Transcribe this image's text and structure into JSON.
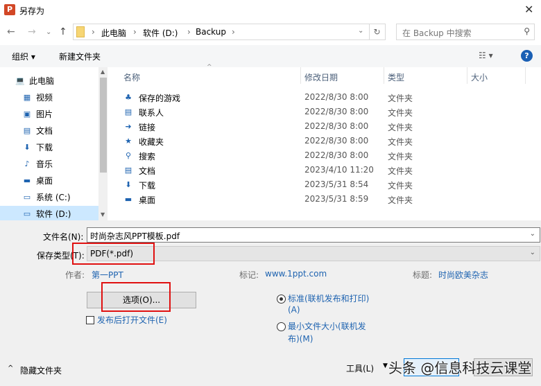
{
  "window": {
    "title": "另存为",
    "close": "✕"
  },
  "address": {
    "crumbs": [
      "此电脑",
      "软件 (D:)",
      "Backup"
    ],
    "search_placeholder": "在 Backup 中搜索"
  },
  "toolbar": {
    "organize": "组织 ▾",
    "new_folder": "新建文件夹",
    "view": "☷ ▾",
    "help": "?"
  },
  "nav": [
    {
      "label": "此电脑",
      "icon": "💻"
    },
    {
      "label": "视频",
      "icon": "▦"
    },
    {
      "label": "图片",
      "icon": "▣"
    },
    {
      "label": "文档",
      "icon": "▤"
    },
    {
      "label": "下载",
      "icon": "⬇"
    },
    {
      "label": "音乐",
      "icon": "♪"
    },
    {
      "label": "桌面",
      "icon": "▬"
    },
    {
      "label": "系统 (C:)",
      "icon": "▭"
    },
    {
      "label": "软件 (D:)",
      "icon": "▭"
    }
  ],
  "columns": {
    "name": "名称",
    "date": "修改日期",
    "type": "类型",
    "size": "大小"
  },
  "files": [
    {
      "name": "保存的游戏",
      "date": "2022/8/30 8:00",
      "type": "文件夹",
      "icon": "♣"
    },
    {
      "name": "联系人",
      "date": "2022/8/30 8:00",
      "type": "文件夹",
      "icon": "▤"
    },
    {
      "name": "链接",
      "date": "2022/8/30 8:00",
      "type": "文件夹",
      "icon": "➜"
    },
    {
      "name": "收藏夹",
      "date": "2022/8/30 8:00",
      "type": "文件夹",
      "icon": "★"
    },
    {
      "name": "搜索",
      "date": "2022/8/30 8:00",
      "type": "文件夹",
      "icon": "⚲"
    },
    {
      "name": "文档",
      "date": "2023/4/10 11:20",
      "type": "文件夹",
      "icon": "▤"
    },
    {
      "name": "下载",
      "date": "2023/5/31 8:54",
      "type": "文件夹",
      "icon": "⬇"
    },
    {
      "name": "桌面",
      "date": "2023/5/31 8:59",
      "type": "文件夹",
      "icon": "▬"
    }
  ],
  "form": {
    "filename_label": "文件名(N):",
    "filename": "时尚杂志风PPT模板.pdf",
    "type_label": "保存类型(T):",
    "type": "PDF(*.pdf)",
    "author_label": "作者:",
    "author": "第一PPT",
    "tags_label": "标记:",
    "tags": "www.1ppt.com",
    "title_label": "标题:",
    "title": "时尚欧美杂志",
    "options": "选项(O)...",
    "open_after": "发布后打开文件(E)",
    "radio_std": "标准(联机发布和打印)",
    "radio_std2": "(A)",
    "radio_min": "最小文件大小(联机发",
    "radio_min2": "布)(M)",
    "hide_folders": "隐藏文件夹",
    "tools": "工具(L)",
    "watermark": "头条 @信息科技云课堂"
  }
}
